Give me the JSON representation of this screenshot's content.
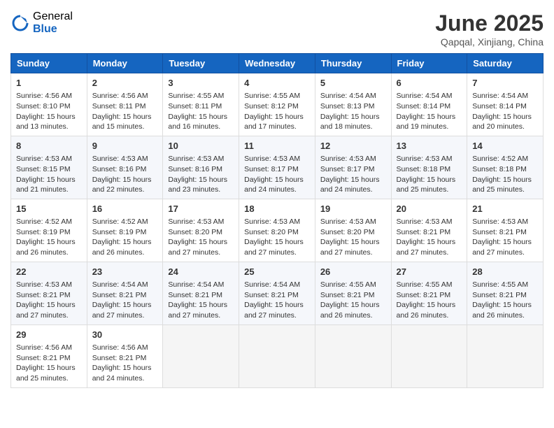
{
  "logo": {
    "general": "General",
    "blue": "Blue"
  },
  "header": {
    "title": "June 2025",
    "subtitle": "Qapqal, Xinjiang, China"
  },
  "weekdays": [
    "Sunday",
    "Monday",
    "Tuesday",
    "Wednesday",
    "Thursday",
    "Friday",
    "Saturday"
  ],
  "weeks": [
    [
      {
        "day": "1",
        "sunrise": "4:56 AM",
        "sunset": "8:10 PM",
        "daylight": "15 hours and 13 minutes."
      },
      {
        "day": "2",
        "sunrise": "4:56 AM",
        "sunset": "8:11 PM",
        "daylight": "15 hours and 15 minutes."
      },
      {
        "day": "3",
        "sunrise": "4:55 AM",
        "sunset": "8:11 PM",
        "daylight": "15 hours and 16 minutes."
      },
      {
        "day": "4",
        "sunrise": "4:55 AM",
        "sunset": "8:12 PM",
        "daylight": "15 hours and 17 minutes."
      },
      {
        "day": "5",
        "sunrise": "4:54 AM",
        "sunset": "8:13 PM",
        "daylight": "15 hours and 18 minutes."
      },
      {
        "day": "6",
        "sunrise": "4:54 AM",
        "sunset": "8:14 PM",
        "daylight": "15 hours and 19 minutes."
      },
      {
        "day": "7",
        "sunrise": "4:54 AM",
        "sunset": "8:14 PM",
        "daylight": "15 hours and 20 minutes."
      }
    ],
    [
      {
        "day": "8",
        "sunrise": "4:53 AM",
        "sunset": "8:15 PM",
        "daylight": "15 hours and 21 minutes."
      },
      {
        "day": "9",
        "sunrise": "4:53 AM",
        "sunset": "8:16 PM",
        "daylight": "15 hours and 22 minutes."
      },
      {
        "day": "10",
        "sunrise": "4:53 AM",
        "sunset": "8:16 PM",
        "daylight": "15 hours and 23 minutes."
      },
      {
        "day": "11",
        "sunrise": "4:53 AM",
        "sunset": "8:17 PM",
        "daylight": "15 hours and 24 minutes."
      },
      {
        "day": "12",
        "sunrise": "4:53 AM",
        "sunset": "8:17 PM",
        "daylight": "15 hours and 24 minutes."
      },
      {
        "day": "13",
        "sunrise": "4:53 AM",
        "sunset": "8:18 PM",
        "daylight": "15 hours and 25 minutes."
      },
      {
        "day": "14",
        "sunrise": "4:52 AM",
        "sunset": "8:18 PM",
        "daylight": "15 hours and 25 minutes."
      }
    ],
    [
      {
        "day": "15",
        "sunrise": "4:52 AM",
        "sunset": "8:19 PM",
        "daylight": "15 hours and 26 minutes."
      },
      {
        "day": "16",
        "sunrise": "4:52 AM",
        "sunset": "8:19 PM",
        "daylight": "15 hours and 26 minutes."
      },
      {
        "day": "17",
        "sunrise": "4:53 AM",
        "sunset": "8:20 PM",
        "daylight": "15 hours and 27 minutes."
      },
      {
        "day": "18",
        "sunrise": "4:53 AM",
        "sunset": "8:20 PM",
        "daylight": "15 hours and 27 minutes."
      },
      {
        "day": "19",
        "sunrise": "4:53 AM",
        "sunset": "8:20 PM",
        "daylight": "15 hours and 27 minutes."
      },
      {
        "day": "20",
        "sunrise": "4:53 AM",
        "sunset": "8:21 PM",
        "daylight": "15 hours and 27 minutes."
      },
      {
        "day": "21",
        "sunrise": "4:53 AM",
        "sunset": "8:21 PM",
        "daylight": "15 hours and 27 minutes."
      }
    ],
    [
      {
        "day": "22",
        "sunrise": "4:53 AM",
        "sunset": "8:21 PM",
        "daylight": "15 hours and 27 minutes."
      },
      {
        "day": "23",
        "sunrise": "4:54 AM",
        "sunset": "8:21 PM",
        "daylight": "15 hours and 27 minutes."
      },
      {
        "day": "24",
        "sunrise": "4:54 AM",
        "sunset": "8:21 PM",
        "daylight": "15 hours and 27 minutes."
      },
      {
        "day": "25",
        "sunrise": "4:54 AM",
        "sunset": "8:21 PM",
        "daylight": "15 hours and 27 minutes."
      },
      {
        "day": "26",
        "sunrise": "4:55 AM",
        "sunset": "8:21 PM",
        "daylight": "15 hours and 26 minutes."
      },
      {
        "day": "27",
        "sunrise": "4:55 AM",
        "sunset": "8:21 PM",
        "daylight": "15 hours and 26 minutes."
      },
      {
        "day": "28",
        "sunrise": "4:55 AM",
        "sunset": "8:21 PM",
        "daylight": "15 hours and 26 minutes."
      }
    ],
    [
      {
        "day": "29",
        "sunrise": "4:56 AM",
        "sunset": "8:21 PM",
        "daylight": "15 hours and 25 minutes."
      },
      {
        "day": "30",
        "sunrise": "4:56 AM",
        "sunset": "8:21 PM",
        "daylight": "15 hours and 24 minutes."
      },
      null,
      null,
      null,
      null,
      null
    ]
  ],
  "labels": {
    "sunrise": "Sunrise:",
    "sunset": "Sunset:",
    "daylight": "Daylight:"
  }
}
